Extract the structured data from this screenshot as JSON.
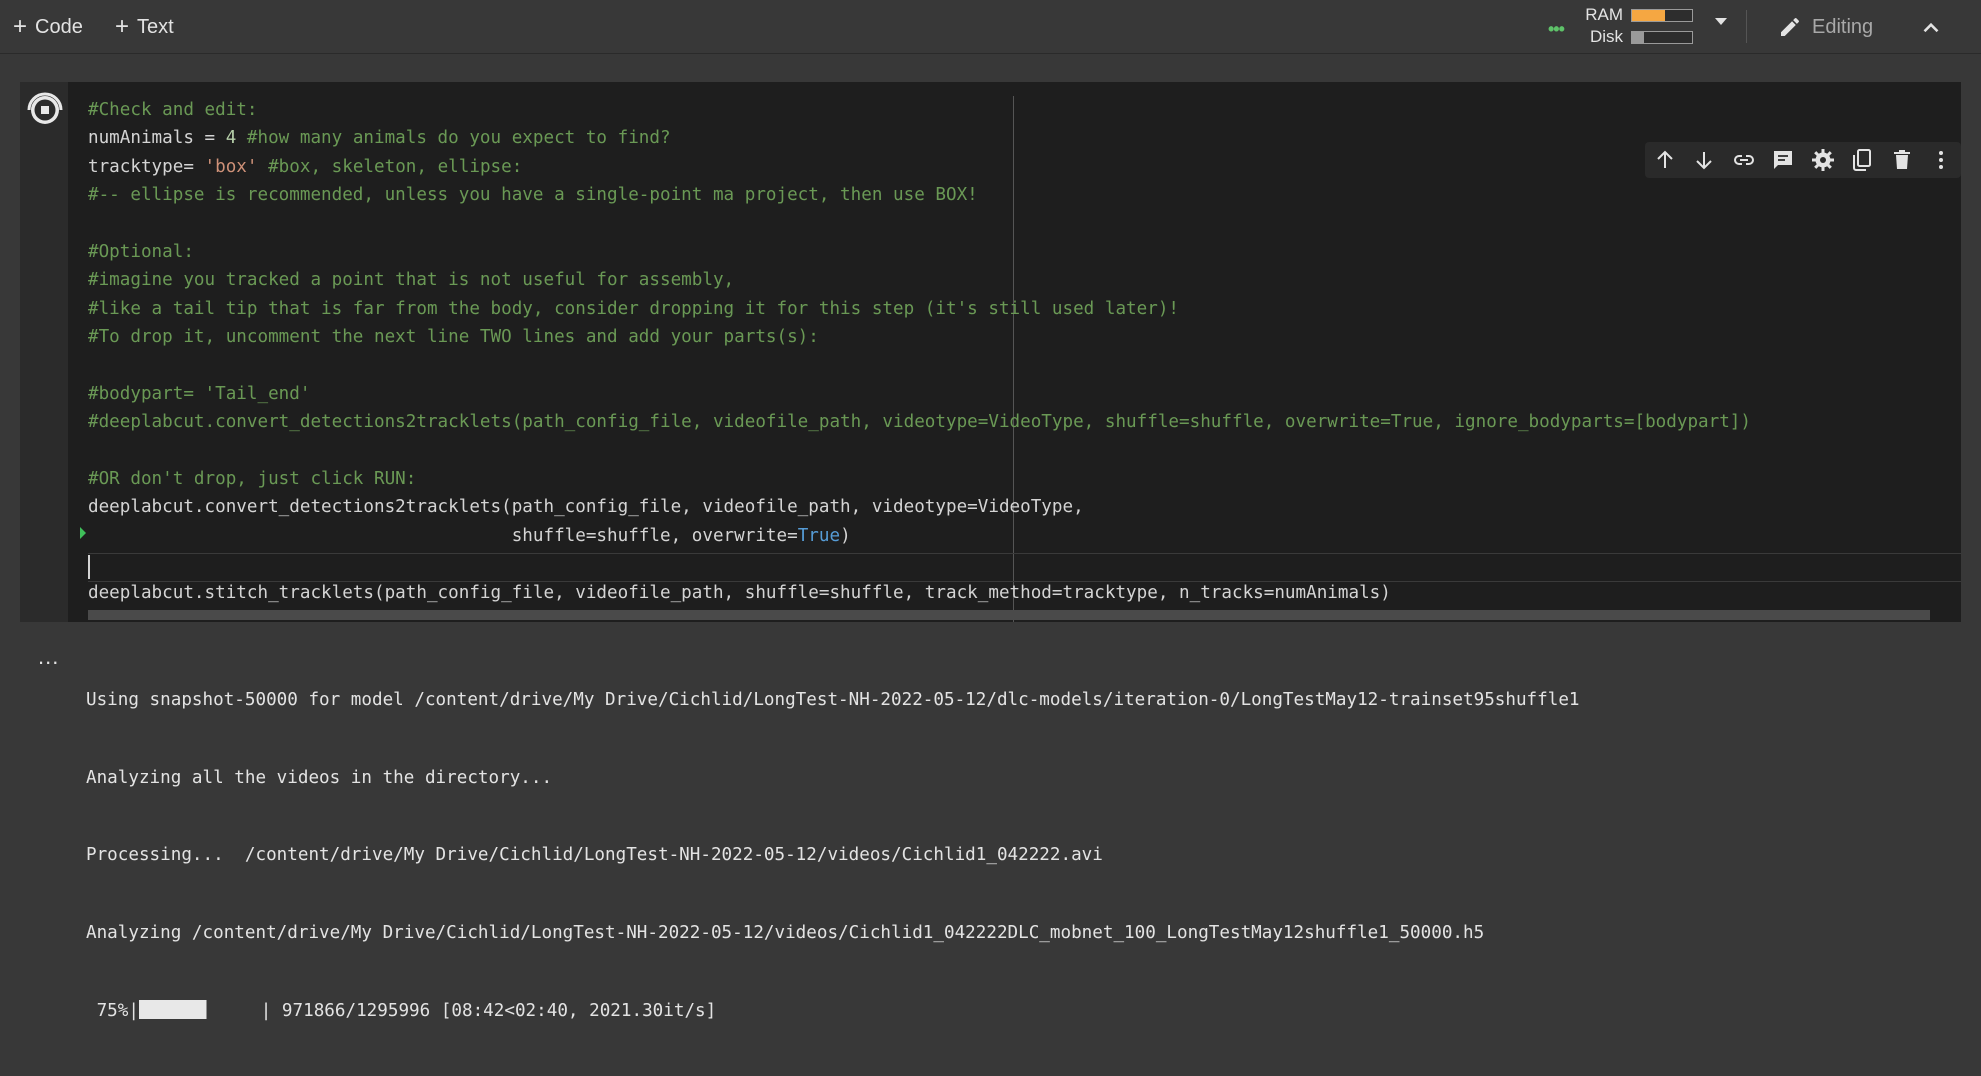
{
  "toolbar": {
    "code_label": "Code",
    "text_label": "Text",
    "ram_label": "RAM",
    "disk_label": "Disk",
    "ram_usage": 0.55,
    "disk_usage": 0.2,
    "editing_label": "Editing"
  },
  "colors": {
    "ram_fill": "#f5a742",
    "disk_fill": "#9a9a9a",
    "connected_dots": "#5ec269",
    "comment": "#6a9955",
    "string": "#ce9178",
    "keyword": "#569cd6"
  },
  "cell": {
    "run_icon": "stop-circle-icon",
    "tools": [
      "arrow-up-icon",
      "arrow-down-icon",
      "link-icon",
      "comment-icon",
      "settings-icon",
      "mirror-cell-icon",
      "delete-icon",
      "more-vert-icon"
    ],
    "code_lines": [
      [
        {
          "t": "c",
          "v": "#Check and edit:"
        }
      ],
      [
        {
          "t": "p",
          "v": "numAnimals = "
        },
        {
          "t": "n",
          "v": "4"
        },
        {
          "t": "c",
          "v": " #how many animals do you expect to find?"
        }
      ],
      [
        {
          "t": "p",
          "v": "tracktype= "
        },
        {
          "t": "s",
          "v": "'box'"
        },
        {
          "t": "c",
          "v": " #box, skeleton, ellipse:"
        }
      ],
      [
        {
          "t": "c",
          "v": "#-- ellipse is recommended, unless you have a single-point ma project, then use BOX!"
        }
      ],
      [],
      [
        {
          "t": "c",
          "v": "#Optional:"
        }
      ],
      [
        {
          "t": "c",
          "v": "#imagine you tracked a point that is not useful for assembly,"
        }
      ],
      [
        {
          "t": "c",
          "v": "#like a tail tip that is far from the body, consider dropping it for this step (it's still used later)!"
        }
      ],
      [
        {
          "t": "c",
          "v": "#To drop it, uncomment the next line TWO lines and add your parts(s):"
        }
      ],
      [],
      [
        {
          "t": "c",
          "v": "#bodypart= 'Tail_end'"
        }
      ],
      [
        {
          "t": "c",
          "v": "#deeplabcut.convert_detections2tracklets(path_config_file, videofile_path, videotype=VideoType, shuffle=shuffle, overwrite=True, ignore_bodyparts=[bodypart])"
        }
      ],
      [],
      [
        {
          "t": "c",
          "v": "#OR don't drop, just click RUN:"
        }
      ],
      [
        {
          "t": "p",
          "v": "deeplabcut.convert_detections2tracklets(path_config_file, videofile_path, videotype=VideoType,"
        }
      ],
      [
        {
          "t": "p",
          "v": "                                        shuffle=shuffle, overwrite="
        },
        {
          "t": "k",
          "v": "True"
        },
        {
          "t": "p",
          "v": ")"
        }
      ],
      [],
      [
        {
          "t": "p",
          "v": "deeplabcut.stitch_tracklets(path_config_file, videofile_path, shuffle=shuffle, track_method=tracktype, n_tracks=numAnimals)"
        }
      ]
    ]
  },
  "output": {
    "more_label": "...",
    "lines": [
      "Using snapshot-50000 for model /content/drive/My Drive/Cichlid/LongTest-NH-2022-05-12/dlc-models/iteration-0/LongTestMay12-trainset95shuffle1",
      "Analyzing all the videos in the directory...",
      "Processing...  /content/drive/My Drive/Cichlid/LongTest-NH-2022-05-12/videos/Cichlid1_042222.avi",
      "Analyzing /content/drive/My Drive/Cichlid/LongTest-NH-2022-05-12/videos/Cichlid1_042222DLC_mobnet_100_LongTestMay12shuffle1_50000.h5"
    ],
    "progress_percent": " 75%|",
    "progress_fraction": 0.75,
    "progress_tail": "   | 971866/1295996 [08:42<02:40, 2021.30it/s]"
  }
}
